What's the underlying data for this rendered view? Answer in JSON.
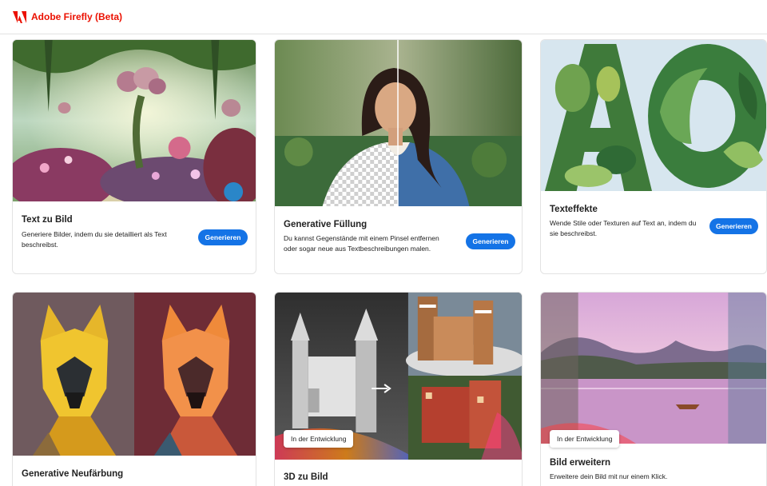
{
  "app": {
    "title": "Adobe Firefly (Beta)"
  },
  "colors": {
    "accent": "#1473e6",
    "brand": "#eb1000"
  },
  "cards": [
    {
      "title": "Text zu Bild",
      "description": "Generiere Bilder, indem du sie detailliert als Text beschreibst.",
      "button": "Generieren"
    },
    {
      "title": "Generative Füllung",
      "description": "Du kannst Gegenstände mit einem Pinsel entfernen oder sogar neue aus Textbeschreibungen malen.",
      "button": "Generieren"
    },
    {
      "title": "Texteffekte",
      "description": "Wende Stile oder Texturen auf Text an, indem du sie beschreibst.",
      "button": "Generieren"
    },
    {
      "title": "Generative Neufärbung",
      "description": "",
      "button": ""
    },
    {
      "title": "3D zu Bild",
      "badge": "In der Entwicklung"
    },
    {
      "title": "Bild erweitern",
      "description": "Erweitere dein Bild mit nur einem Klick.",
      "badge": "In der Entwicklung"
    }
  ]
}
